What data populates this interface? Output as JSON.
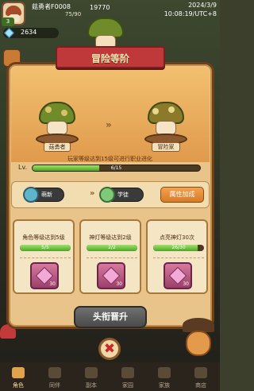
{
  "topbar": {
    "player_name": "菇勇者F0008",
    "player_level": "3",
    "stat_small": "75/90",
    "stat_big": "19770",
    "date": "2024/3/9",
    "time": "10:08:19/UTC+8",
    "gems": "2634"
  },
  "panel": {
    "title": "冒险等阶",
    "from_label": "菇勇者",
    "to_label": "冒险家",
    "hint": "玩家等级达到15级可进行职业进化",
    "lv_label": "Lv.",
    "progress_text": "6/15",
    "progress_fraction": 0.4,
    "attr_from": "萌新",
    "attr_to": "学徒",
    "attr_button": "属性加成"
  },
  "tasks": [
    {
      "title": "角色等级达到5级",
      "progress": "5/5",
      "fraction": 1.0,
      "reward": "30"
    },
    {
      "title": "神灯等级达到2级",
      "progress": "2/2",
      "fraction": 1.0,
      "reward": "30"
    },
    {
      "title": "点亮神灯30次",
      "progress": "26/30",
      "fraction": 0.87,
      "reward": "30"
    }
  ],
  "promote_button": "头衔晋升",
  "close_glyph": "✖",
  "nav": [
    {
      "label": "角色",
      "active": true
    },
    {
      "label": "同伴",
      "active": false
    },
    {
      "label": "副本",
      "active": false
    },
    {
      "label": "家园",
      "active": false
    },
    {
      "label": "家族",
      "active": false
    },
    {
      "label": "商店",
      "active": false
    }
  ],
  "colors": {
    "banner": "#c0393a",
    "panel": "#e9c48a",
    "progress": "#4ea428",
    "promote_button": "#4a4a4a"
  }
}
